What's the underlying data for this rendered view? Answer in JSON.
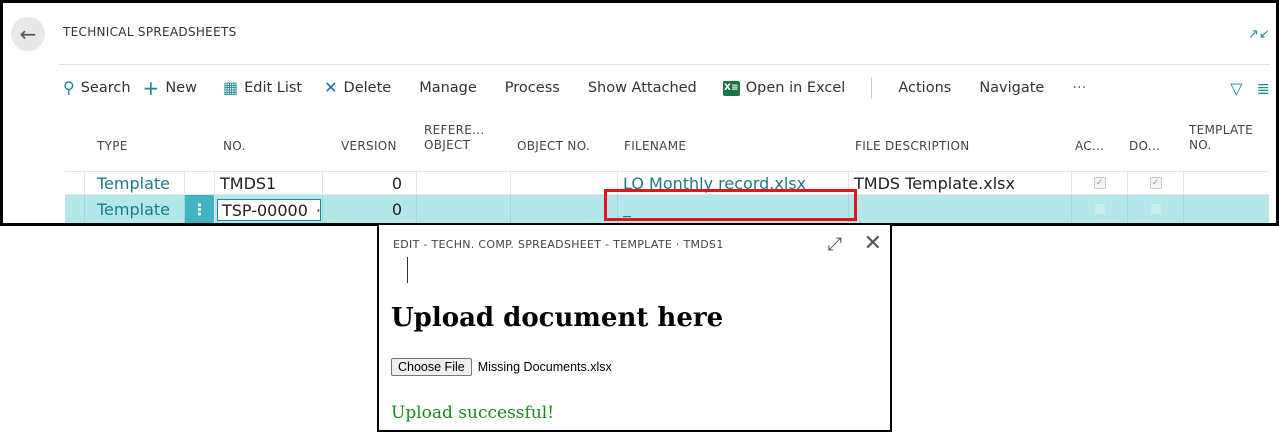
{
  "page": {
    "title": "TECHNICAL SPREADSHEETS"
  },
  "actions": {
    "search": "Search",
    "new": "New",
    "edit_list": "Edit List",
    "delete": "Delete",
    "manage": "Manage",
    "process": "Process",
    "show_attached": "Show Attached",
    "open_in_excel": "Open in Excel",
    "actions": "Actions",
    "navigate": "Navigate",
    "more": "···"
  },
  "table": {
    "headers": {
      "type": "TYPE",
      "no": "NO.",
      "version": "VERSION",
      "ref_object_1": "REFERE...",
      "ref_object_2": "OBJECT",
      "object_no": "OBJECT NO.",
      "filename": "FILENAME",
      "file_description": "FILE DESCRIPTION",
      "ac": "AC...",
      "do": "DO...",
      "template_no_1": "TEMPLATE",
      "template_no_2": "NO."
    },
    "rows": [
      {
        "type": "Template",
        "no": "TMDS1",
        "version": "0",
        "filename": "LO Monthly record.xlsx",
        "file_description": "TMDS Template.xlsx",
        "ac_checked": true,
        "do_checked": true
      },
      {
        "type": "Template",
        "row_menu": "⋮",
        "no": "TSP-00000",
        "no_lookup": "···",
        "version": "0",
        "filename": "_",
        "file_description": "",
        "ac_checked": false,
        "do_checked": false
      }
    ]
  },
  "dialog": {
    "title": "EDIT - TECHN. COMP. SPREADSHEET - TEMPLATE · TMDS1",
    "heading": "Upload document here",
    "choose_file_label": "Choose File",
    "chosen_file": "Missing Documents.xlsx",
    "status": "Upload successful!"
  },
  "colors": {
    "accent": "#1a8a96",
    "selected_row": "#b4e7ea",
    "highlight_box": "#e0161d",
    "success": "#1b8a1b"
  }
}
